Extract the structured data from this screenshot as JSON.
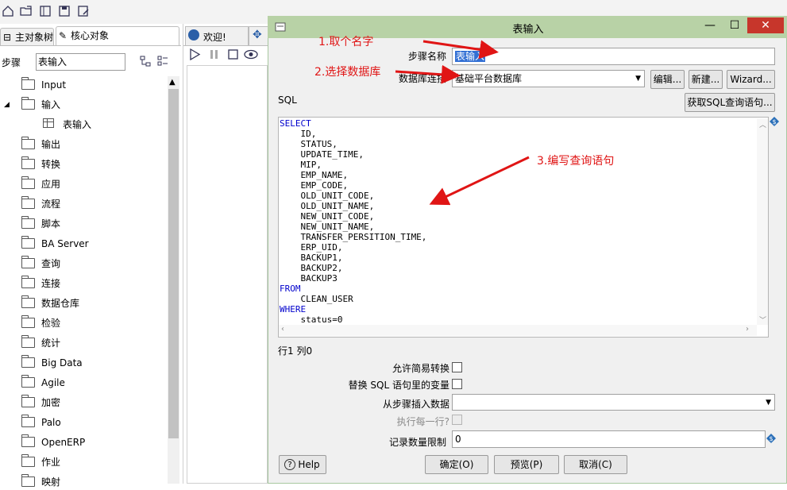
{
  "left_panel": {
    "tabs": [
      "主对象树",
      "核心对象"
    ],
    "steps_label": "步骤",
    "search_value": "表输入",
    "tree": [
      "Input",
      "输入",
      "表输入",
      "输出",
      "转换",
      "应用",
      "流程",
      "脚本",
      "BA Server",
      "查询",
      "连接",
      "数据仓库",
      "检验",
      "统计",
      "Big Data",
      "Agile",
      "加密",
      "Palo",
      "OpenERP",
      "作业",
      "映射"
    ]
  },
  "middle_panel": {
    "tab_label": "欢迎!"
  },
  "dialog": {
    "title": "表输入",
    "window_buttons": [
      "—",
      "☐",
      "✕"
    ],
    "step_name_label": "步骤名称",
    "step_name_value": "表输入",
    "db_conn_label": "数据库连接",
    "db_conn_value": "基础平台数据库",
    "edit_button": "编辑...",
    "new_button": "新建...",
    "wizard_button": "Wizard...",
    "sql_label": "SQL",
    "get_sql_button": "获取SQL查询语句...",
    "sql_lines": [
      {
        "kw": "SELECT",
        "text": ""
      },
      {
        "kw": "",
        "text": "    ID,"
      },
      {
        "kw": "",
        "text": "    STATUS,"
      },
      {
        "kw": "",
        "text": "    UPDATE_TIME,"
      },
      {
        "kw": "",
        "text": "    MIP,"
      },
      {
        "kw": "",
        "text": "    EMP_NAME,"
      },
      {
        "kw": "",
        "text": "    EMP_CODE,"
      },
      {
        "kw": "",
        "text": "    OLD_UNIT_CODE,"
      },
      {
        "kw": "",
        "text": "    OLD_UNIT_NAME,"
      },
      {
        "kw": "",
        "text": "    NEW_UNIT_CODE,"
      },
      {
        "kw": "",
        "text": "    NEW_UNIT_NAME,"
      },
      {
        "kw": "",
        "text": "    TRANSFER_PERSITION_TIME,"
      },
      {
        "kw": "",
        "text": "    ERP_UID,"
      },
      {
        "kw": "",
        "text": "    BACKUP1,"
      },
      {
        "kw": "",
        "text": "    BACKUP2,"
      },
      {
        "kw": "",
        "text": "    BACKUP3"
      },
      {
        "kw": "FROM",
        "text": ""
      },
      {
        "kw": "",
        "text": "    CLEAN_USER"
      },
      {
        "kw": "WHERE",
        "text": ""
      },
      {
        "kw": "",
        "text": "    status=0"
      }
    ],
    "cursor_pos": "行1 列0",
    "allow_lazy_label": "允许简易转换",
    "replace_vars_label": "替换 SQL 语句里的变量",
    "insert_from_step_label": "从步骤插入数据",
    "execute_each_row_label": "执行每一行?",
    "limit_label": "记录数量限制",
    "limit_value": "0",
    "help_button": "Help",
    "ok_button": "确定(O)",
    "preview_button": "预览(P)",
    "cancel_button": "取消(C)"
  },
  "annotations": {
    "a1": "1.取个名字",
    "a2": "2.选择数据库",
    "a3": "3.编写查询语句"
  },
  "colors": {
    "annotation": "#e01515",
    "dialog_titlebar": "#b8d2a6",
    "sql_keyword": "#0000cc"
  }
}
